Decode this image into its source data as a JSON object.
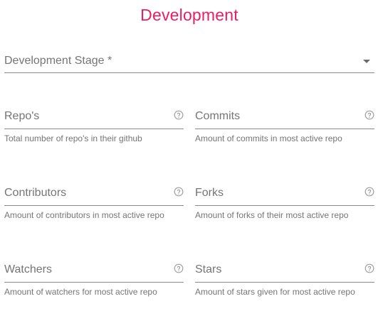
{
  "header": {
    "title": "Development"
  },
  "development_stage": {
    "label": "Development Stage *",
    "selected_value": ""
  },
  "fields": [
    {
      "label": "Repo's",
      "value": "",
      "helper": "Total number of repo's in their github",
      "icon": "help-circle-icon"
    },
    {
      "label": "Commits",
      "value": "",
      "helper": "Amount of commits in most active repo",
      "icon": "help-circle-icon"
    },
    {
      "label": "Contributors",
      "value": "",
      "helper": "Amount of contributors in most active repo",
      "icon": "help-circle-icon"
    },
    {
      "label": "Forks",
      "value": "",
      "helper": "Amount of forks of their most active repo",
      "icon": "help-circle-icon"
    },
    {
      "label": "Watchers",
      "value": "",
      "helper": "Amount of watchers for most active repo",
      "icon": "help-circle-icon"
    },
    {
      "label": "Stars",
      "value": "",
      "helper": "Amount of stars given for most active repo",
      "icon": "help-circle-icon"
    }
  ],
  "colors": {
    "accent": "#e91e63",
    "label": "#757575",
    "underline": "#8a8a8a"
  }
}
